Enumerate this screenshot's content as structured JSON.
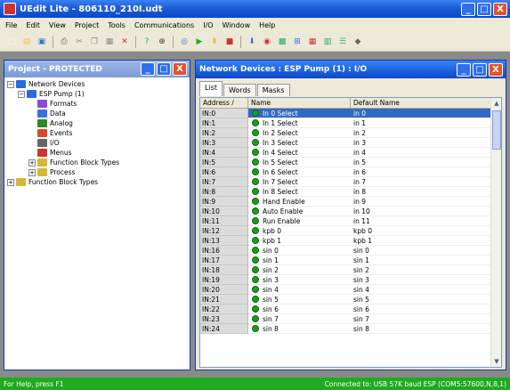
{
  "app": {
    "title": "UEdit Lite - 806110_210I.udt"
  },
  "window_buttons": {
    "min": "_",
    "max": "□",
    "close": "X"
  },
  "menu": [
    "File",
    "Edit",
    "View",
    "Project",
    "Tools",
    "Communications",
    "I/O",
    "Window",
    "Help"
  ],
  "toolbar": {
    "icons": [
      "new-icon",
      "open-icon",
      "save-icon",
      "print-icon",
      "cut-icon",
      "copy-icon",
      "paste-icon",
      "delete-icon",
      "help-icon",
      "zoom-icon",
      "connect-icon",
      "run-icon",
      "pause-icon",
      "stop-icon",
      "download-icon",
      "monitor-icon",
      "chart-icon",
      "tree-icon",
      "grid-icon",
      "config-icon",
      "list-icon",
      "tag-icon"
    ]
  },
  "project_window": {
    "title": "Project - PROTECTED",
    "tree": [
      {
        "label": "Network Devices",
        "level": 0,
        "expander": "−",
        "icon": "network-icon"
      },
      {
        "label": "ESP Pump (1)",
        "level": 1,
        "expander": "−",
        "icon": "device-icon"
      },
      {
        "label": "Formats",
        "level": 2,
        "icon": "formats-icon"
      },
      {
        "label": "Data",
        "level": 2,
        "icon": "data-icon"
      },
      {
        "label": "Analog",
        "level": 2,
        "icon": "analog-icon"
      },
      {
        "label": "Events",
        "level": 2,
        "icon": "events-icon"
      },
      {
        "label": "I/O",
        "level": 2,
        "icon": "io-icon"
      },
      {
        "label": "Menus",
        "level": 2,
        "icon": "menus-icon"
      },
      {
        "label": "Function Block Types",
        "level": 2,
        "expander": "+",
        "icon": "folder-icon"
      },
      {
        "label": "Process",
        "level": 2,
        "expander": "+",
        "icon": "folder-icon"
      },
      {
        "label": "Function Block Types",
        "level": 0,
        "expander": "+",
        "icon": "folder-icon"
      }
    ]
  },
  "device_window": {
    "title": "Network Devices : ESP Pump (1) : I/O",
    "tabs": [
      "List",
      "Words",
      "Masks"
    ],
    "active_tab": "List",
    "columns": {
      "address": "Address /",
      "name": "Name",
      "default": "Default Name"
    },
    "rows": [
      {
        "addr": "IN:0",
        "name": "In 0 Select",
        "def": "in 0",
        "selected": true
      },
      {
        "addr": "IN:1",
        "name": "In 1 Select",
        "def": "in 1"
      },
      {
        "addr": "IN:2",
        "name": "In 2 Select",
        "def": "in 2"
      },
      {
        "addr": "IN:3",
        "name": "In 3 Select",
        "def": "in 3"
      },
      {
        "addr": "IN:4",
        "name": "In 4 Select",
        "def": "in 4"
      },
      {
        "addr": "IN:5",
        "name": "In 5 Select",
        "def": "in 5"
      },
      {
        "addr": "IN:6",
        "name": "In 6 Select",
        "def": "in 6"
      },
      {
        "addr": "IN:7",
        "name": "In 7 Select",
        "def": "in 7"
      },
      {
        "addr": "IN:8",
        "name": "In 8 Select",
        "def": "in 8"
      },
      {
        "addr": "IN:9",
        "name": "Hand Enable",
        "def": "in 9"
      },
      {
        "addr": "IN:10",
        "name": "Auto Enable",
        "def": "in 10"
      },
      {
        "addr": "IN:11",
        "name": "Run Enable",
        "def": "in 11"
      },
      {
        "addr": "IN:12",
        "name": "kpb 0",
        "def": "kpb 0"
      },
      {
        "addr": "IN:13",
        "name": "kpb 1",
        "def": "kpb 1"
      },
      {
        "addr": "IN:16",
        "name": "sin 0",
        "def": "sin 0"
      },
      {
        "addr": "IN:17",
        "name": "sin 1",
        "def": "sin 1"
      },
      {
        "addr": "IN:18",
        "name": "sin 2",
        "def": "sin 2"
      },
      {
        "addr": "IN:19",
        "name": "sin 3",
        "def": "sin 3"
      },
      {
        "addr": "IN:20",
        "name": "sin 4",
        "def": "sin 4"
      },
      {
        "addr": "IN:21",
        "name": "sin 5",
        "def": "sin 5"
      },
      {
        "addr": "IN:22",
        "name": "sin 6",
        "def": "sin 6"
      },
      {
        "addr": "IN:23",
        "name": "sin 7",
        "def": "sin 7"
      },
      {
        "addr": "IN:24",
        "name": "sin 8",
        "def": "sin 8"
      }
    ]
  },
  "status": {
    "left": "For Help, press F1",
    "right": "Connected to: USB  57K baud ESP (COM5:57600,N,8,1)"
  },
  "colors": {
    "titlebar": "#0a48c8",
    "selection": "#316ac5",
    "status": "#1faa1f",
    "io_on": "#1f9a1f"
  }
}
